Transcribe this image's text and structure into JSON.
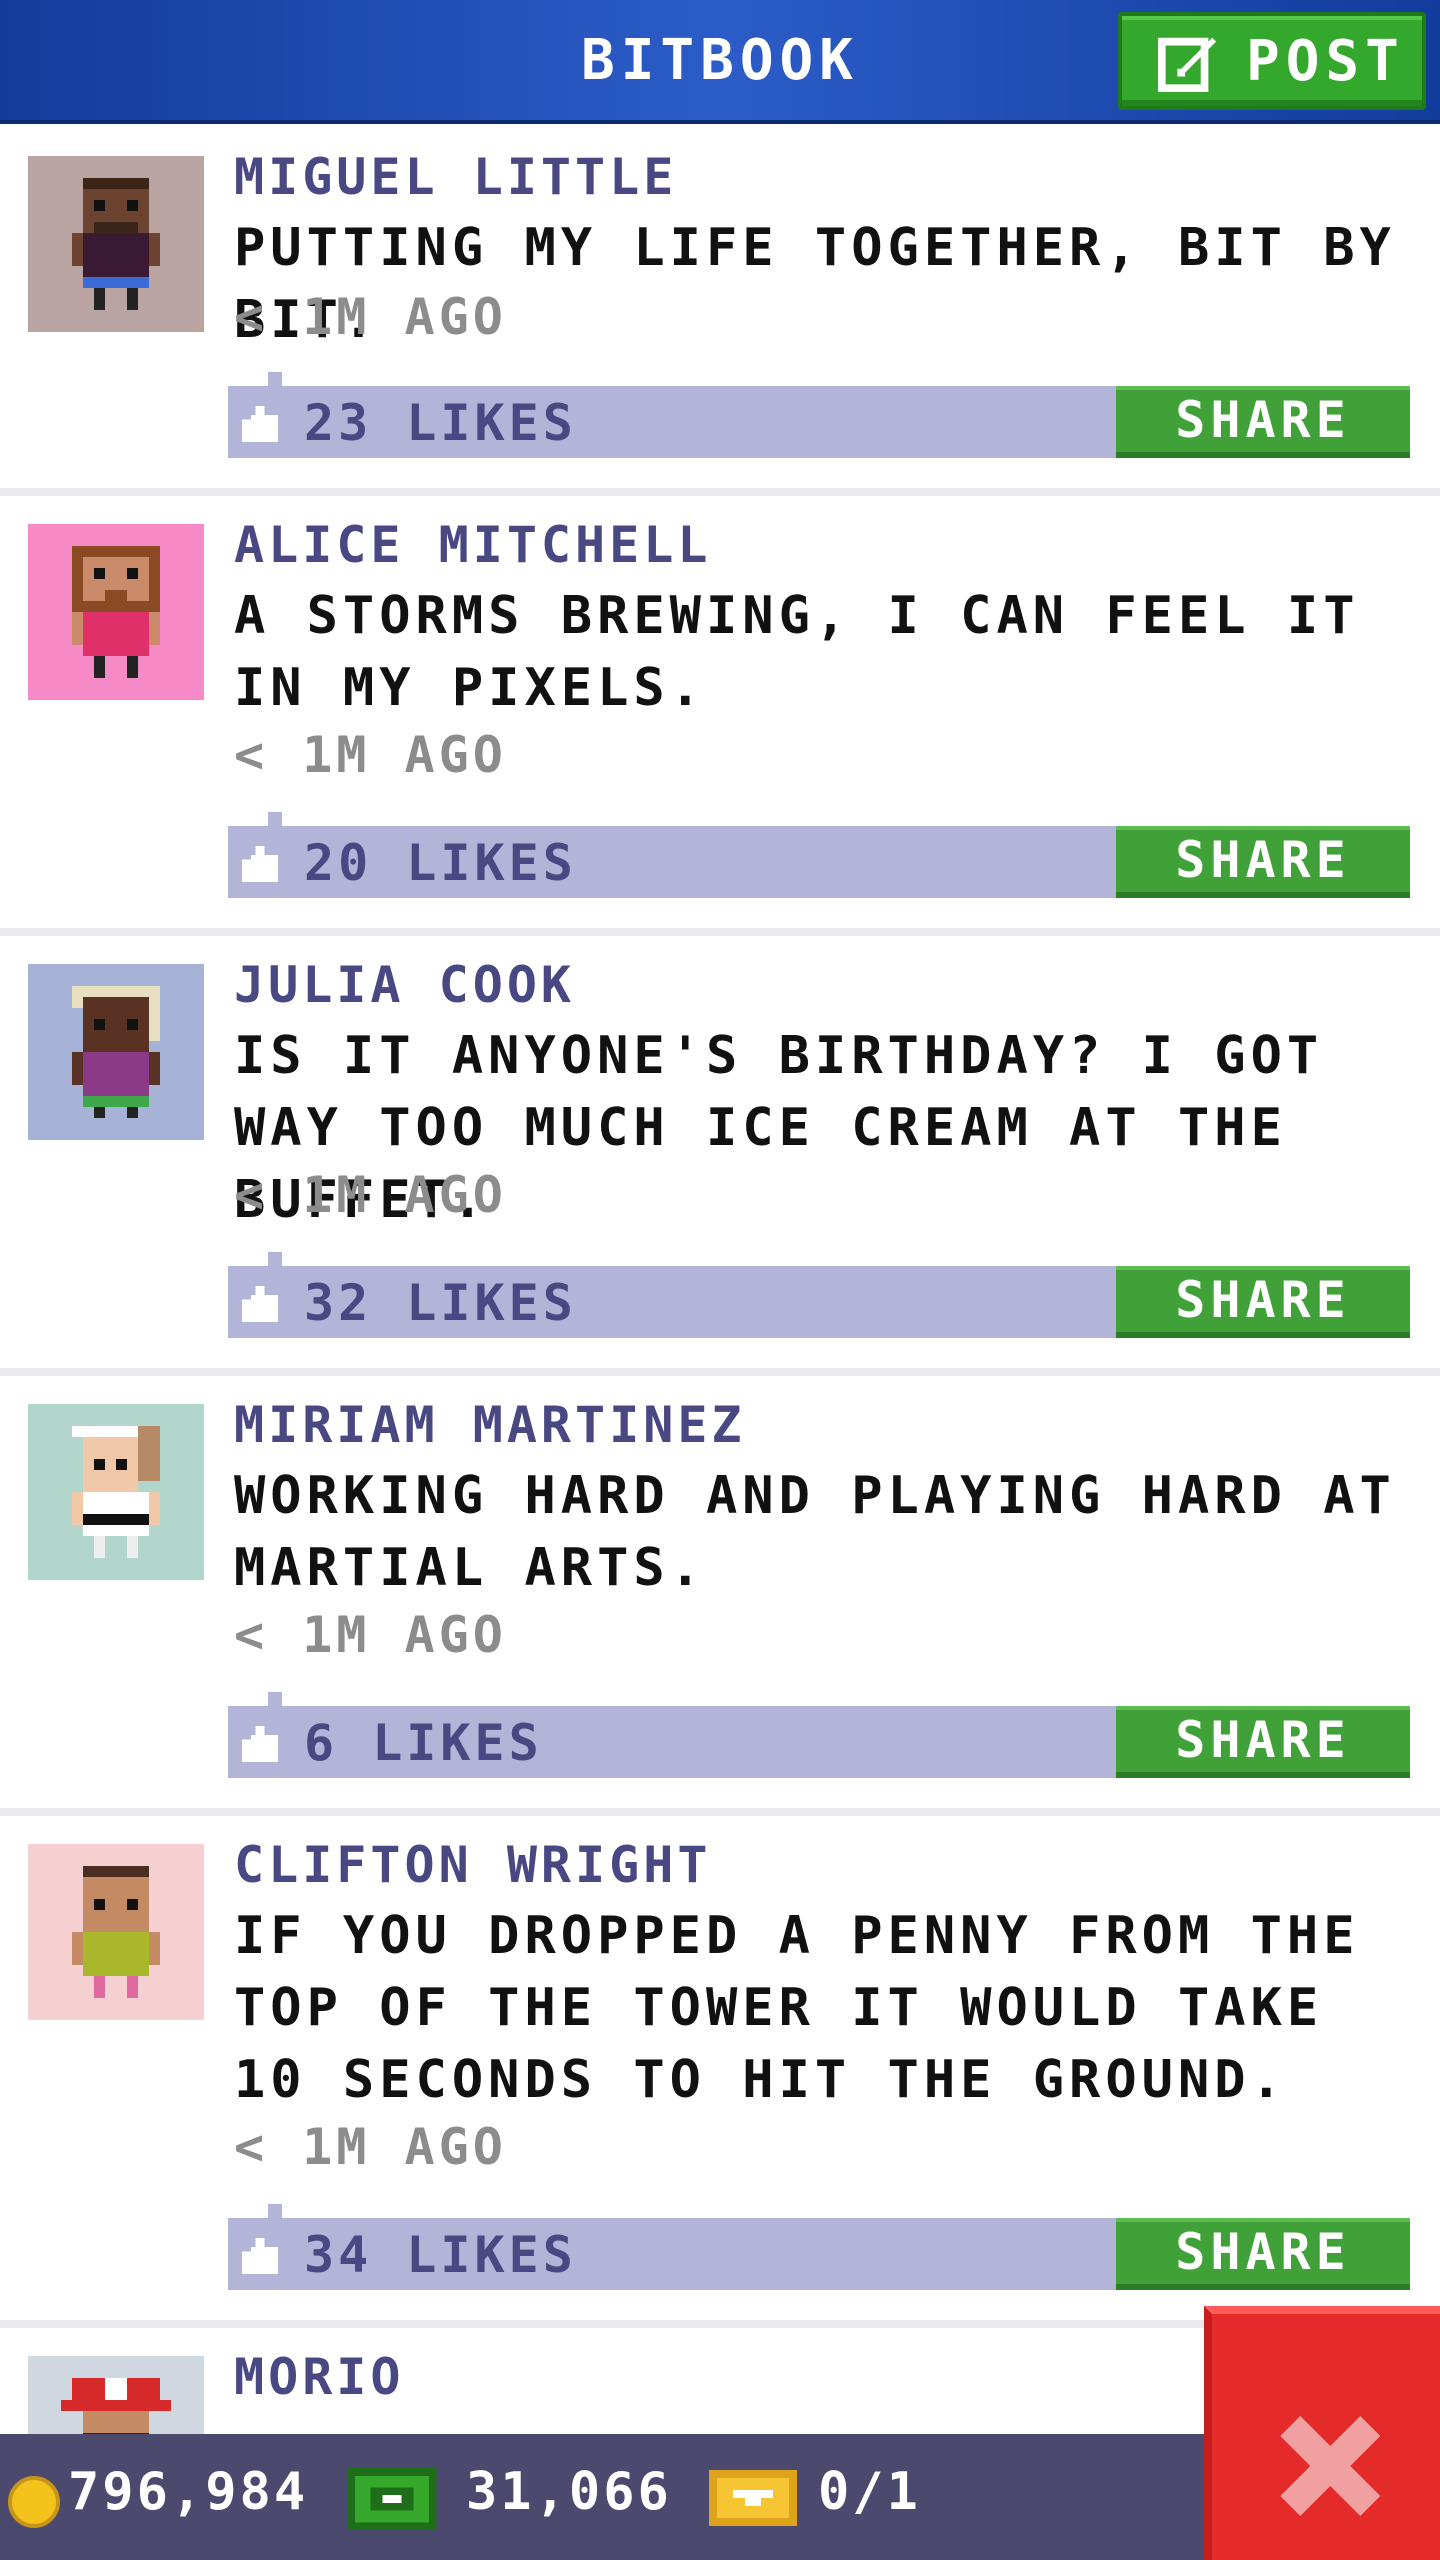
{
  "header": {
    "title": "BITBOOK",
    "post_label": "POST"
  },
  "posts": [
    {
      "author": "MIGUEL LITTLE",
      "text": "PUTTING MY LIFE TOGETHER, BIT BY BIT.",
      "time": "< 1M AGO",
      "likes": "23 LIKES",
      "share": "SHARE"
    },
    {
      "author": "ALICE MITCHELL",
      "text": "A STORMS BREWING, I CAN FEEL IT IN MY PIXELS.",
      "time": "< 1M AGO",
      "likes": "20 LIKES",
      "share": "SHARE"
    },
    {
      "author": "JULIA COOK",
      "text": "IS IT ANYONE'S BIRTHDAY? I GOT WAY TOO MUCH ICE CREAM AT THE BUFFET.",
      "time": "< 1M AGO",
      "likes": "32 LIKES",
      "share": "SHARE"
    },
    {
      "author": "MIRIAM MARTINEZ",
      "text": "WORKING HARD AND PLAYING HARD AT MARTIAL ARTS.",
      "time": "< 1M AGO",
      "likes": "6 LIKES",
      "share": "SHARE"
    },
    {
      "author": "CLIFTON WRIGHT",
      "text": "IF YOU DROPPED A PENNY FROM THE TOP OF THE TOWER IT WOULD TAKE 10 SECONDS TO HIT THE GROUND.",
      "time": "< 1M AGO",
      "likes": "34 LIKES",
      "share": "SHARE"
    },
    {
      "author": "MORIO"
    }
  ],
  "status_bar": {
    "coins": "796,984",
    "bux": "31,066",
    "tickets": "0/1"
  }
}
